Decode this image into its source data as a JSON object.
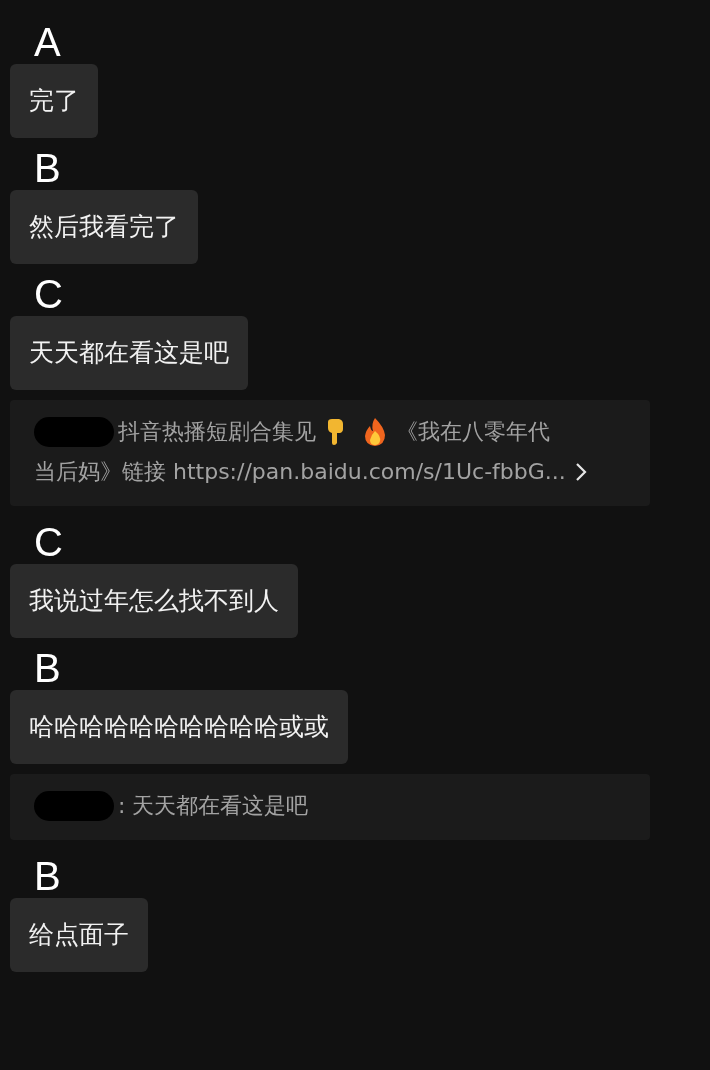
{
  "messages": [
    {
      "kind": "sender",
      "name": "A"
    },
    {
      "kind": "bubble",
      "text": "完了"
    },
    {
      "kind": "sender",
      "name": "B"
    },
    {
      "kind": "bubble",
      "text": "然后我看完了"
    },
    {
      "kind": "sender",
      "name": "C"
    },
    {
      "kind": "bubble",
      "text": "天天都在看这是吧"
    },
    {
      "kind": "quote",
      "redacted": true,
      "lines": [
        [
          {
            "kind": "text",
            "text": "抖音热播短剧合集见"
          },
          {
            "kind": "hand"
          },
          {
            "kind": "fire"
          },
          {
            "kind": "text",
            "text": "《我在八零年代"
          }
        ],
        [
          {
            "kind": "text",
            "text": "当后妈》链接 https://pan.baidu.com/s/1Uc-fbbG..."
          },
          {
            "kind": "chevron"
          }
        ]
      ]
    },
    {
      "kind": "sender",
      "name": "C"
    },
    {
      "kind": "bubble",
      "text": "我说过年怎么找不到人"
    },
    {
      "kind": "sender",
      "name": "B"
    },
    {
      "kind": "bubble",
      "text": "哈哈哈哈哈哈哈哈哈哈或或"
    },
    {
      "kind": "quote",
      "redacted": true,
      "lines": [
        [
          {
            "kind": "text",
            "text": ": 天天都在看这是吧"
          }
        ]
      ]
    },
    {
      "kind": "sender",
      "name": "B"
    },
    {
      "kind": "bubble",
      "text": "给点面子"
    }
  ]
}
